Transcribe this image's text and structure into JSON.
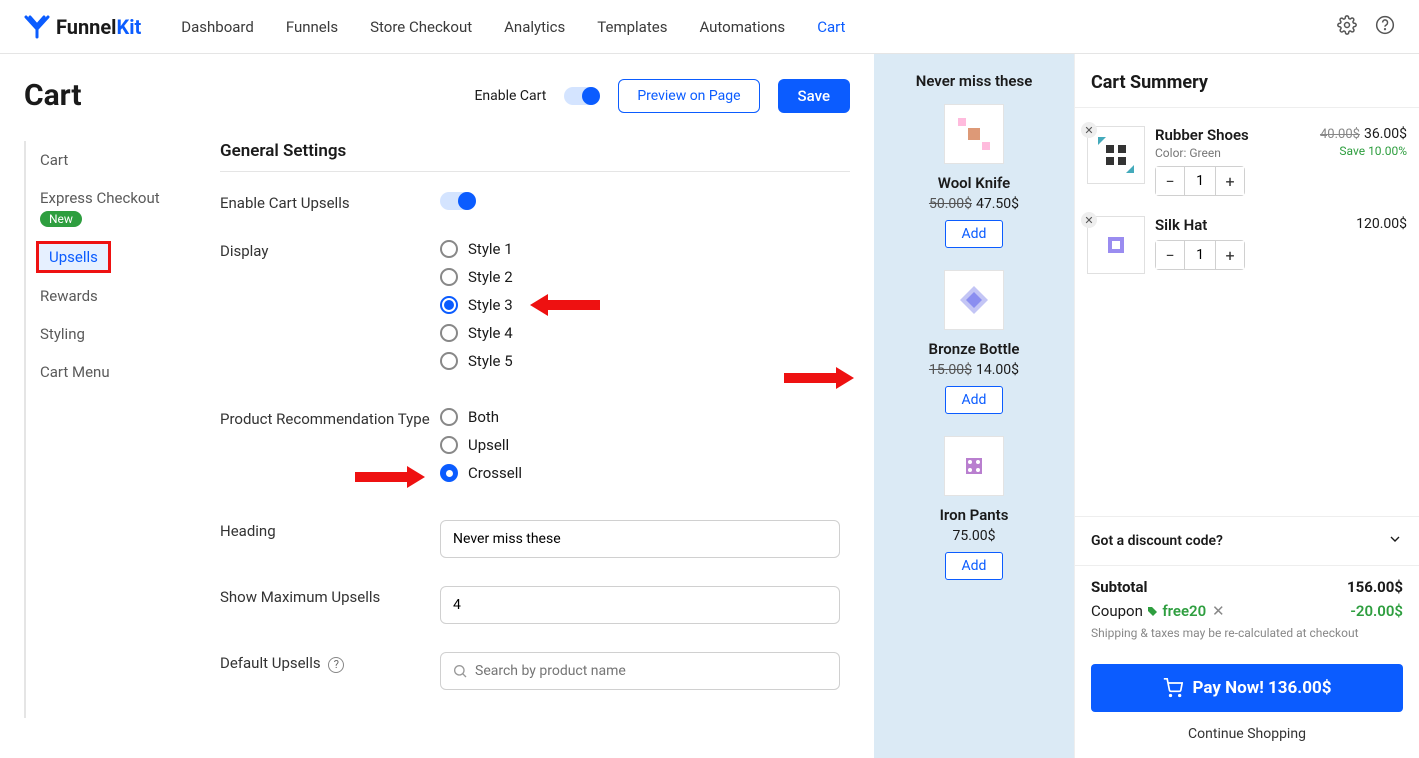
{
  "brand": {
    "part1": "Funnel",
    "part2": "Kit"
  },
  "nav": {
    "dashboard": "Dashboard",
    "funnels": "Funnels",
    "checkout": "Store Checkout",
    "analytics": "Analytics",
    "templates": "Templates",
    "automations": "Automations",
    "cart": "Cart"
  },
  "pageTitle": "Cart",
  "head": {
    "enableCart": "Enable Cart",
    "preview": "Preview on Page",
    "save": "Save"
  },
  "sidenav": {
    "cart": "Cart",
    "express": "Express Checkout",
    "new": "New",
    "upsells": "Upsells",
    "rewards": "Rewards",
    "styling": "Styling",
    "menu": "Cart Menu"
  },
  "settings": {
    "title": "General Settings",
    "enableUpsells": "Enable Cart Upsells",
    "display": "Display",
    "styles": {
      "s1": "Style 1",
      "s2": "Style 2",
      "s3": "Style 3",
      "s4": "Style 4",
      "s5": "Style 5"
    },
    "recType": "Product Recommendation Type",
    "rec": {
      "both": "Both",
      "upsell": "Upsell",
      "crossell": "Crossell"
    },
    "headingLbl": "Heading",
    "headingVal": "Never miss these",
    "maxLbl": "Show Maximum Upsells",
    "maxVal": "4",
    "defaultLbl": "Default Upsells",
    "searchPh": "Search by product name"
  },
  "preview": {
    "title": "Never miss these",
    "p1": {
      "name": "Wool Knife",
      "old": "50.00$",
      "price": "47.50$",
      "btn": "Add"
    },
    "p2": {
      "name": "Bronze Bottle",
      "old": "15.00$",
      "price": "14.00$",
      "btn": "Add"
    },
    "p3": {
      "name": "Iron Pants",
      "price": "75.00$",
      "btn": "Add"
    }
  },
  "cart": {
    "title": "Cart Summery",
    "i1": {
      "name": "Rubber Shoes",
      "opt": "Color: Green",
      "old": "40.00$",
      "price": "36.00$",
      "save": "Save 10.00%",
      "qty": "1"
    },
    "i2": {
      "name": "Silk Hat",
      "price": "120.00$",
      "qty": "1"
    },
    "discount": "Got a discount code?",
    "subLbl": "Subtotal",
    "subVal": "156.00$",
    "couponLbl": "Coupon",
    "couponCode": "free20",
    "couponVal": "-20.00$",
    "taxNote": "Shipping & taxes may be re-calculated at checkout",
    "pay": "Pay Now!  136.00$",
    "continue": "Continue Shopping"
  }
}
